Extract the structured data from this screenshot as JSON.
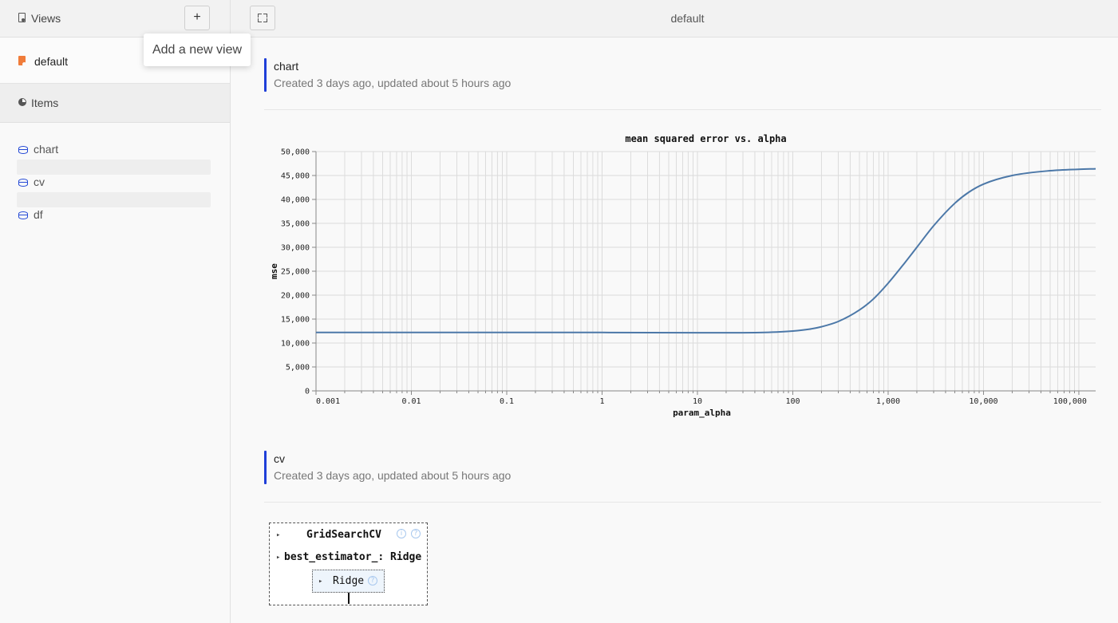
{
  "sidebar": {
    "views_label": "Views",
    "add_button_label": "+",
    "add_tooltip": "Add a new view",
    "active_view": "default",
    "items_label": "Items",
    "items": [
      {
        "label": "chart",
        "icon": "database-icon"
      },
      {
        "label": "cv",
        "icon": "database-icon"
      },
      {
        "label": "df",
        "icon": "database-icon"
      }
    ]
  },
  "topbar": {
    "title": "default"
  },
  "cards": [
    {
      "name": "chart",
      "meta": "Created 3 days ago, updated about 5 hours ago"
    },
    {
      "name": "cv",
      "meta": "Created 3 days ago, updated about 5 hours ago"
    }
  ],
  "colors": {
    "accent": "#1f3fd8",
    "line": "#4c78a8",
    "view_icon": "#f07c3a"
  },
  "chart_data": {
    "type": "line",
    "title": "mean squared error vs. alpha",
    "xlabel": "param_alpha",
    "ylabel": "mse",
    "x_scale": "log",
    "xlim": [
      0.001,
      150000
    ],
    "ylim": [
      0,
      50000
    ],
    "grid": true,
    "x_tick_labels": [
      "0.001",
      "0.01",
      "0.1",
      "1",
      "10",
      "100",
      "1,000",
      "10,000",
      "100,000"
    ],
    "y_tick_labels": [
      "0",
      "5,000",
      "10,000",
      "15,000",
      "20,000",
      "25,000",
      "30,000",
      "35,000",
      "40,000",
      "45,000",
      "50,000"
    ],
    "series": [
      {
        "x": [
          0.001,
          0.01,
          0.1,
          1,
          10,
          30,
          50,
          100,
          150,
          200,
          300,
          500,
          700,
          1000,
          1500,
          2000,
          3000,
          5000,
          7000,
          10000,
          20000,
          50000,
          100000,
          150000
        ],
        "y": [
          12200,
          12200,
          12200,
          12200,
          12150,
          12150,
          12200,
          12500,
          12900,
          13400,
          14500,
          16900,
          19200,
          22500,
          26800,
          30000,
          34500,
          39200,
          41500,
          43200,
          45000,
          46000,
          46300,
          46400
        ]
      }
    ]
  },
  "estimator": {
    "top_label": "GridSearchCV",
    "best_label": "best_estimator_: Ridge",
    "inner_label": "Ridge",
    "info_glyph": "i",
    "help_glyph": "?",
    "expand_glyph": "▸"
  }
}
